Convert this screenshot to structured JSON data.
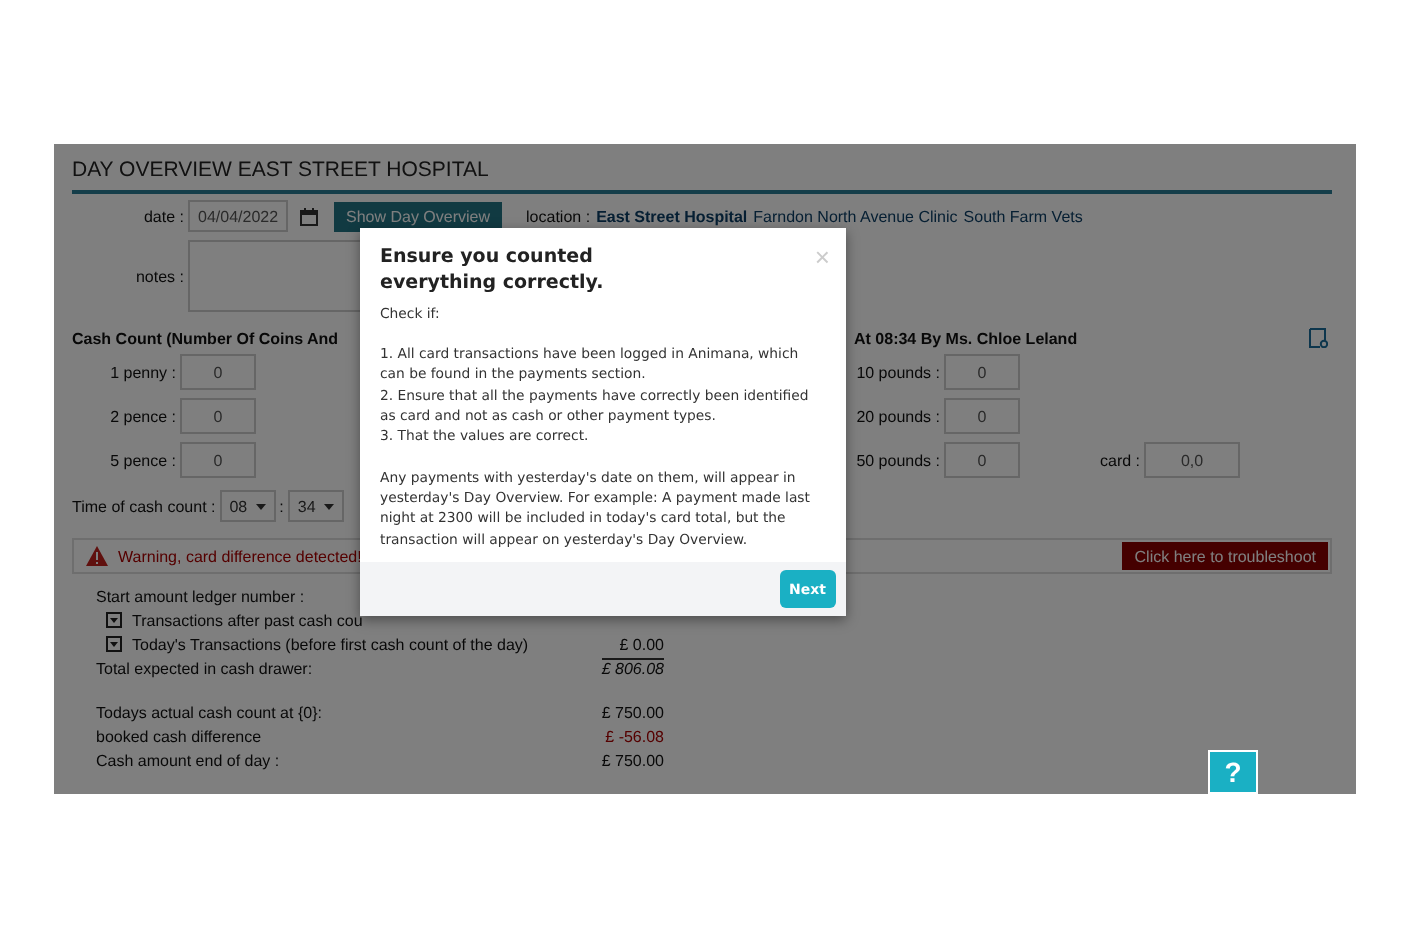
{
  "page": {
    "title": "DAY OVERVIEW EAST STREET HOSPITAL",
    "date_label": "date :",
    "date": "04/04/2022",
    "show_button": "Show Day Overview",
    "location_label": "location :",
    "notes_label": "notes :",
    "locations": [
      {
        "name": "East Street Hospital",
        "selected": true
      },
      {
        "name": "Farndon North Avenue Clinic",
        "selected": false
      },
      {
        "name": "South Farm Vets",
        "selected": false
      }
    ]
  },
  "cash_count": {
    "heading": "Cash Count (Number Of Coins And",
    "heading_right": "At 08:34 By Ms. Chloe Leland",
    "left": [
      {
        "label": "1 penny :",
        "value": "0"
      },
      {
        "label": "2 pence :",
        "value": "0"
      },
      {
        "label": "5 pence :",
        "value": "0"
      }
    ],
    "right": [
      {
        "label": "10 pounds :",
        "value": "0"
      },
      {
        "label": "20 pounds :",
        "value": "0"
      },
      {
        "label": "50 pounds :",
        "value": "0"
      }
    ],
    "card": {
      "label": "card :",
      "value": "0,0"
    },
    "time_label": "Time of cash count :",
    "hour": "08",
    "time_separator": ":",
    "minute": "34"
  },
  "warning": {
    "text": "Warning, card difference detected!",
    "button": "Click here to troubleshoot"
  },
  "ledger": [
    {
      "kind": "plain",
      "label": "Start amount ledger number :"
    },
    {
      "kind": "expandable",
      "label": "Transactions after past cash cou"
    },
    {
      "kind": "expandable",
      "label": "Today's Transactions (before first cash count of the day)",
      "value": "£ 0.00"
    },
    {
      "kind": "total",
      "label": "Total expected in cash drawer:",
      "value": "£ 806.08"
    },
    {
      "kind": "spacer"
    },
    {
      "kind": "plain",
      "label": "Todays actual cash count at {0}:",
      "value": "£ 750.00"
    },
    {
      "kind": "negative",
      "label": "booked cash difference",
      "value": "£ -56.08"
    },
    {
      "kind": "plain",
      "label": "Cash amount end of day :",
      "value": "£ 750.00"
    }
  ],
  "modal": {
    "title": "Ensure you counted everything correctly.",
    "close": "×",
    "paragraphs": [
      "Check if:",
      "1. All card transactions have been logged in Animana, which can be found in the payments section.\n2. Ensure that all the payments have correctly been identified as card and not as cash or other payment types.\n3. That the values are correct.",
      "Any payments with yesterday's date on them, will appear in yesterday's Day Overview.  For example: A payment made last night at 2300 will be included in today's card total, but the transaction will appear on yesterday's Day Overview."
    ],
    "button": "Next"
  },
  "help": "?"
}
